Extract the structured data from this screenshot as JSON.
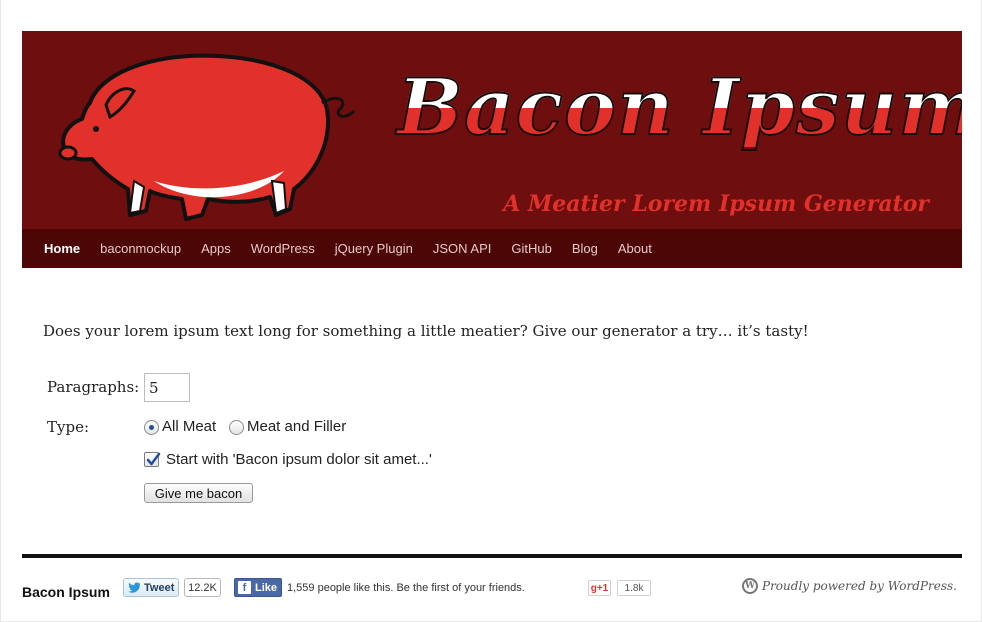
{
  "header": {
    "site_title": "Bacon Ipsum",
    "tagline": "A Meatier Lorem Ipsum Generator",
    "banner_bg": "#6e0e0e",
    "accent": "#e2312a"
  },
  "nav": {
    "items": [
      {
        "label": "Home",
        "active": true
      },
      {
        "label": "baconmockup"
      },
      {
        "label": "Apps"
      },
      {
        "label": "WordPress"
      },
      {
        "label": "jQuery Plugin"
      },
      {
        "label": "JSON API"
      },
      {
        "label": "GitHub"
      },
      {
        "label": "Blog"
      },
      {
        "label": "About"
      }
    ]
  },
  "main": {
    "intro": "Does your lorem ipsum text long for something a little meatier? Give our generator a try… it’s tasty!",
    "form": {
      "paragraphs_label": "Paragraphs:",
      "paragraphs_value": "5",
      "type_label": "Type:",
      "type_options": [
        {
          "label": "All Meat",
          "selected": true
        },
        {
          "label": "Meat and Filler",
          "selected": false
        }
      ],
      "start_with_label": "Start with 'Bacon ipsum dolor sit amet...'",
      "start_with_checked": true,
      "submit_label": "Give me bacon"
    }
  },
  "footer": {
    "site_name": "Bacon Ipsum",
    "tweet_label": "Tweet",
    "tweet_count": "12.2K",
    "like_label": "Like",
    "like_text": "1,559 people like this. Be the first of your friends.",
    "gplus_label": "g+1",
    "gplus_count": "1.8k",
    "powered_by": "Proudly powered by WordPress."
  }
}
